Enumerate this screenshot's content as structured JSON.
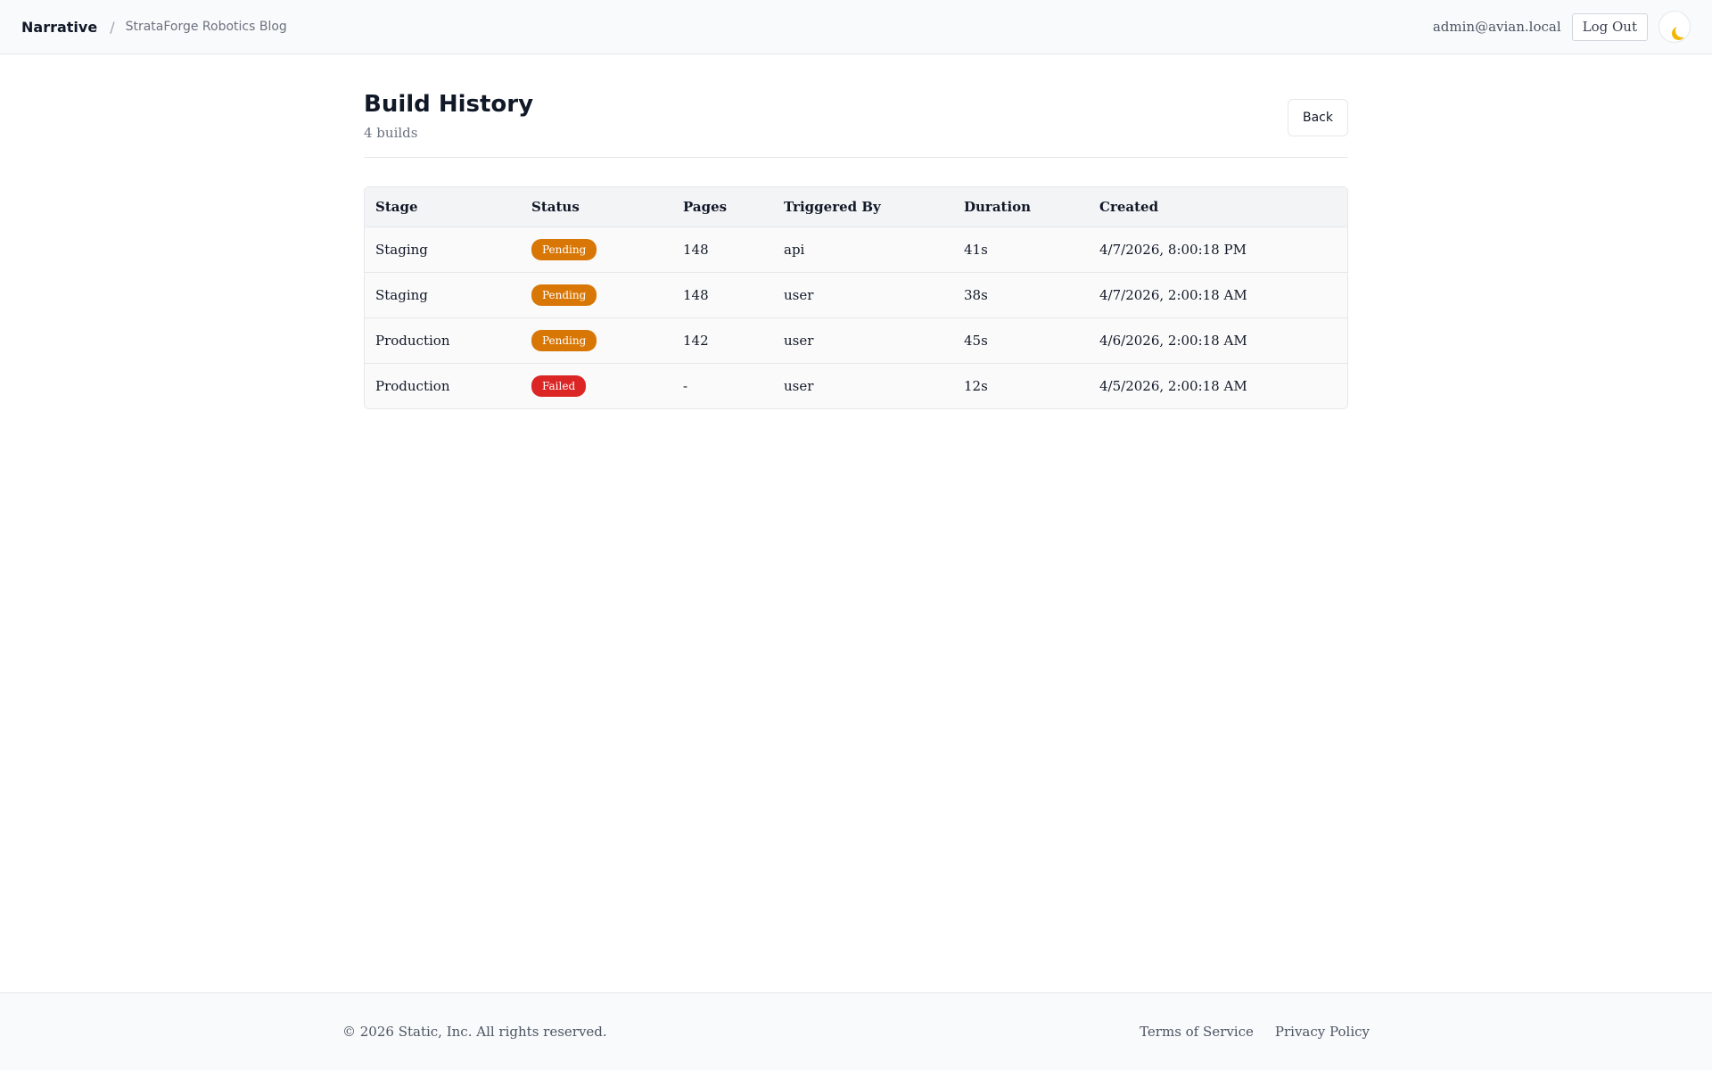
{
  "header": {
    "brand": "Narrative",
    "separator": "/",
    "blog_name": "StrataForge Robotics Blog",
    "user_email": "admin@avian.local",
    "logout_label": "Log Out",
    "theme_icon": "moon-icon"
  },
  "page": {
    "title": "Build History",
    "subtitle": "4 builds",
    "back_label": "Back"
  },
  "table": {
    "columns": [
      "Stage",
      "Status",
      "Pages",
      "Triggered By",
      "Duration",
      "Created"
    ],
    "rows": [
      {
        "stage": "Staging",
        "status": "Pending",
        "pages": "148",
        "triggered_by": "api",
        "duration": "41s",
        "created": "4/7/2026, 8:00:18 PM"
      },
      {
        "stage": "Staging",
        "status": "Pending",
        "pages": "148",
        "triggered_by": "user",
        "duration": "38s",
        "created": "4/7/2026, 2:00:18 AM"
      },
      {
        "stage": "Production",
        "status": "Pending",
        "pages": "142",
        "triggered_by": "user",
        "duration": "45s",
        "created": "4/6/2026, 2:00:18 AM"
      },
      {
        "stage": "Production",
        "status": "Failed",
        "pages": "-",
        "triggered_by": "user",
        "duration": "12s",
        "created": "4/5/2026, 2:00:18 AM"
      }
    ]
  },
  "footer": {
    "copyright": "© 2026 Static, Inc. All rights reserved.",
    "terms_label": "Terms of Service",
    "privacy_label": "Privacy Policy"
  },
  "colors": {
    "pending": "#d97706",
    "failed": "#dc2626",
    "moon": "#f2b705"
  }
}
